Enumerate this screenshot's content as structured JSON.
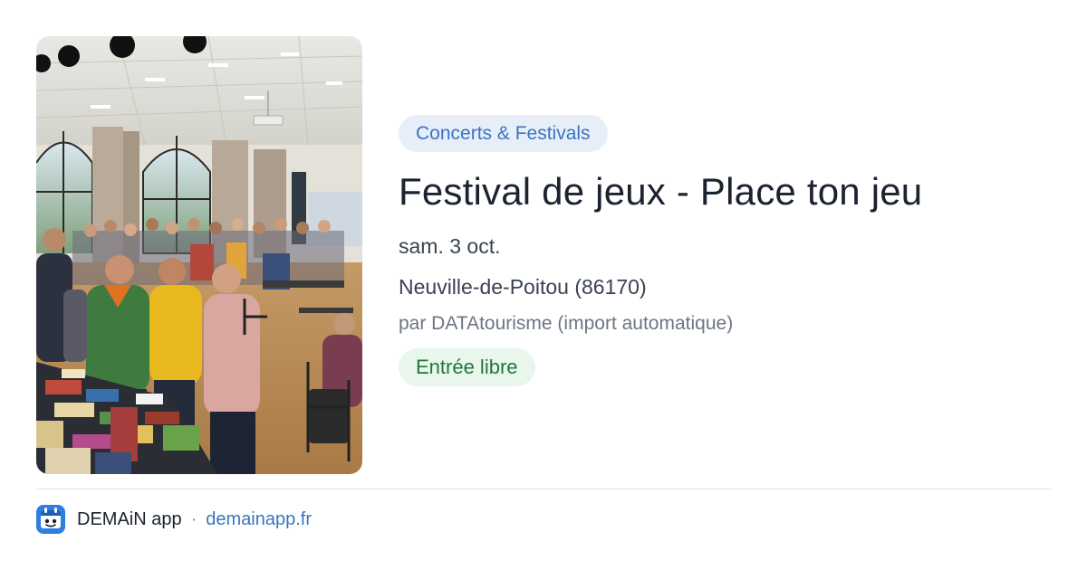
{
  "event": {
    "photo_alt": "Festival de jeux - Place ton jeu",
    "category": "Concerts & Festivals",
    "title": "Festival de jeux - Place ton jeu",
    "date": "sam. 3 oct.",
    "location": "Neuville-de-Poitou (86170)",
    "organizer": "par DATAtourisme (import automatique)",
    "price": "Entrée libre"
  },
  "footer": {
    "app_name": "DEMAiN app",
    "separator": "·",
    "site": "demainapp.fr"
  },
  "colors": {
    "accent": "#3a74c2",
    "category_bg": "#e7eef8",
    "price_text": "#24753b",
    "price_bg": "#e8f6ec",
    "title_text": "#1b2230"
  },
  "icons": {
    "app": "demain-app-icon"
  }
}
